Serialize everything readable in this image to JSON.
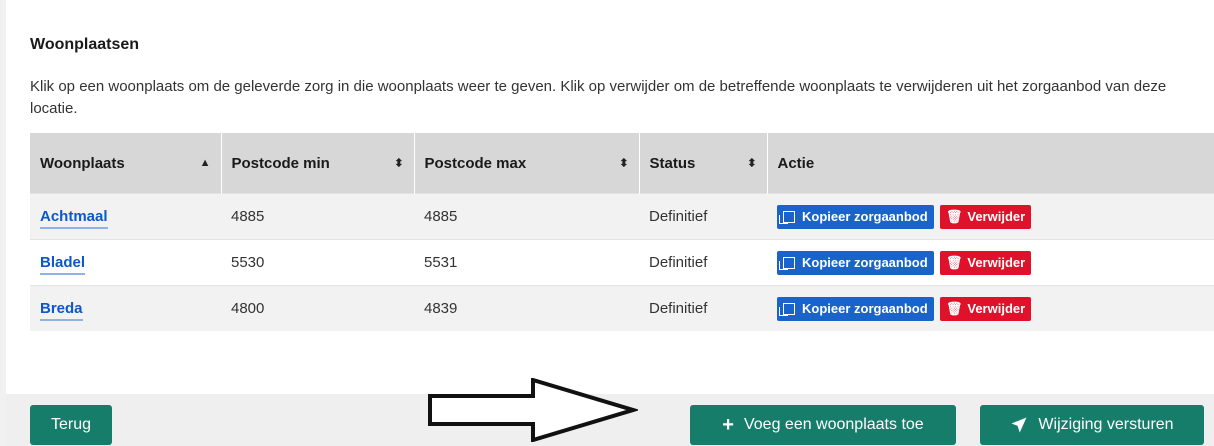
{
  "section": {
    "title": "Woonplaatsen",
    "description": "Klik op een woonplaats om de geleverde zorg in die woonplaats weer te geven. Klik op verwijder om de betreffende woonplaats te verwijderen uit het zorgaanbod van deze locatie."
  },
  "table": {
    "headers": [
      "Woonplaats",
      "Postcode min",
      "Postcode max",
      "Status",
      "Actie"
    ],
    "rows": [
      {
        "woonplaats": "Achtmaal",
        "postcode_min": "4885",
        "postcode_max": "4885",
        "status": "Definitief"
      },
      {
        "woonplaats": "Bladel",
        "postcode_min": "5530",
        "postcode_max": "5531",
        "status": "Definitief"
      },
      {
        "woonplaats": "Breda",
        "postcode_min": "4800",
        "postcode_max": "4839",
        "status": "Definitief"
      }
    ],
    "action_labels": {
      "copy": "Kopieer zorgaanbod",
      "delete": "Verwijder"
    }
  },
  "footer": {
    "back_label": "Terug",
    "add_label": "Voeg een woonplaats toe",
    "send_label": "Wijziging versturen"
  },
  "colors": {
    "link": "#0a58ca",
    "copy_button": "#1a63c9",
    "delete_button": "#e0112b",
    "primary_button": "#157d6a"
  }
}
